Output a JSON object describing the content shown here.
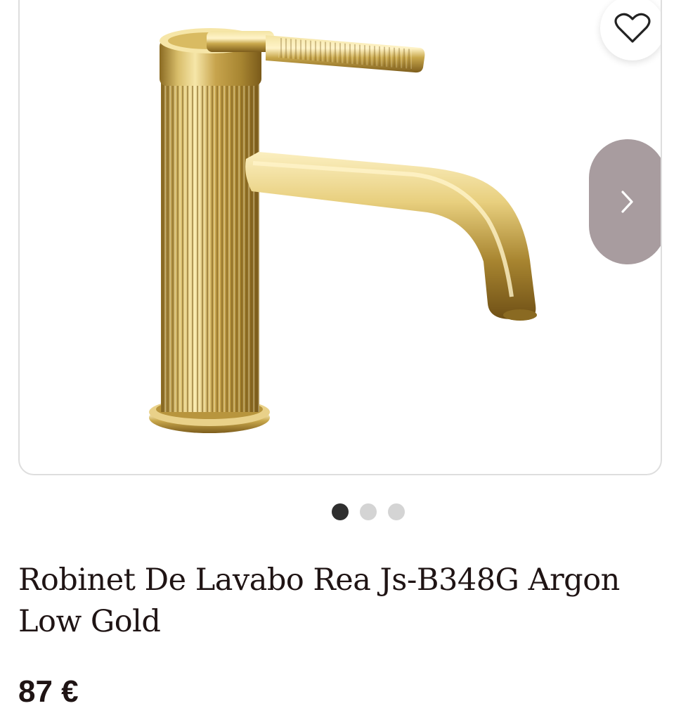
{
  "product": {
    "title": "Robinet De Lavabo Rea Js-B348G Argon Low Gold",
    "price": "87 €"
  },
  "gallery": {
    "image_subject": "gold-faucet",
    "slide_count": 3,
    "active_slide": 1,
    "icons": {
      "wishlist": "heart-icon",
      "next": "chevron-right-icon"
    }
  },
  "colors": {
    "text": "#1f1414",
    "next_button_bg": "#a89c9f",
    "dot_active": "#2f2f2f",
    "dot_inactive": "#d4d4d4",
    "card_border": "#dedede",
    "gold": "#c9a84c"
  }
}
